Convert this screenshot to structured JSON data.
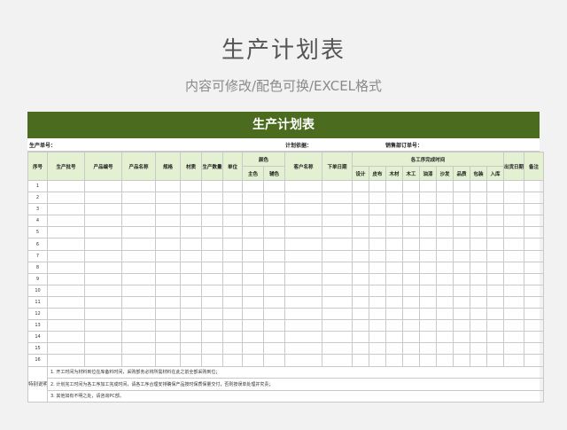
{
  "page": {
    "title": "生产计划表",
    "subtitle": "内容可修改/配色可换/EXCEL格式"
  },
  "sheet": {
    "banner": "生产计划表",
    "info": {
      "order_no": "生产单号：",
      "plan_basis": "计划依据：",
      "sales_order": "销售部订单号："
    },
    "headers": {
      "seq": "序号",
      "batch": "生产批号",
      "code": "产品编号",
      "name": "产品名称",
      "spec": "规格",
      "material": "材质",
      "qty": "生产数量",
      "unit": "单位",
      "color": "颜色",
      "color_main": "主色",
      "color_aux": "辅色",
      "customer": "客户名称",
      "order_date": "下单日期",
      "process_time": "各工序完成时间",
      "processes": [
        "设计",
        "皮布",
        "木材",
        "木工",
        "油漆",
        "沙发",
        "品质",
        "包装",
        "入库"
      ],
      "ship_date": "出货日期",
      "remark": "备注"
    },
    "rows": [
      "1",
      "2",
      "3",
      "4",
      "5",
      "6",
      "7",
      "8",
      "9",
      "10",
      "11",
      "12",
      "13",
      "14",
      "15",
      "16"
    ],
    "notes_label": "特别说明",
    "notes": [
      "1. 开工时间为材料到位在库备料时间，采购部务必将所需材料在此之前全部采购到位；",
      "2. 计划完工时间为各工序加工完成时间，请各工序合理安排确保产品按时保质保量交付，否则按误单处理并究责；",
      "3. 其他如有不明之处，请咨询PC部。"
    ]
  }
}
